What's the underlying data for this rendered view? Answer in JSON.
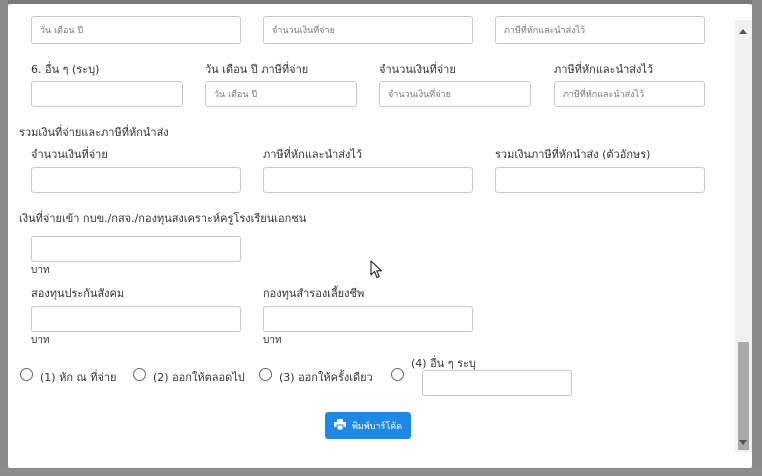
{
  "top_row": {
    "date_placeholder": "วัน เดือน ปี",
    "amount_placeholder": "จำนวนเงินที่จ่าย",
    "tax_placeholder": "ภาษีที่หักและนำส่งไว้"
  },
  "other_row": {
    "title": "6. อื่น ๆ (ระบุ)",
    "date_label": "วัน เดือน ปี ภาษีที่จ่าย",
    "date_placeholder": "วัน เดือน ปี",
    "amount_label": "จำนวนเงินที่จ่าย",
    "amount_placeholder": "จำนวนเงินที่จ่าย",
    "tax_label": "ภาษีที่หักและนำส่งไว้",
    "tax_placeholder": "ภาษีที่หักและนำส่งไว้"
  },
  "totals": {
    "section_title": "รวมเงินที่จ่ายและภาษีที่หักนำส่ง",
    "amount_label": "จำนวนเงินที่จ่าย",
    "tax_label": "ภาษีที่หักและนำส่งไว้",
    "tax_text_label": "รวมเงินภาษีที่หักนำส่ง (ตัวอักษร)"
  },
  "fund": {
    "section_title": "เงินที่จ่ายเข้า กบข./กสจ./กองทุนสงเคราะห์ครูโรงเรียนเอกชน",
    "unit": "บาท"
  },
  "social": {
    "title": "สองทุนประกันสังคม",
    "unit": "บาท"
  },
  "provident": {
    "title": "กองทุนสำรองเลี้ยงชีพ",
    "unit": "บาท"
  },
  "payer_options": {
    "opt1": "(1) หัก ณ ที่จ่าย",
    "opt2": "(2) ออกให้ตลอดไป",
    "opt3": "(3) ออกให้ครั้งเดียว",
    "opt4": "(4) อื่น ๆ ระบุ"
  },
  "print_button": {
    "label": "พิมพ์บาร์โค้ด",
    "icon": "printer-icon"
  },
  "colors": {
    "primary": "#1e88e5",
    "overlay": "#7a7a7a"
  }
}
